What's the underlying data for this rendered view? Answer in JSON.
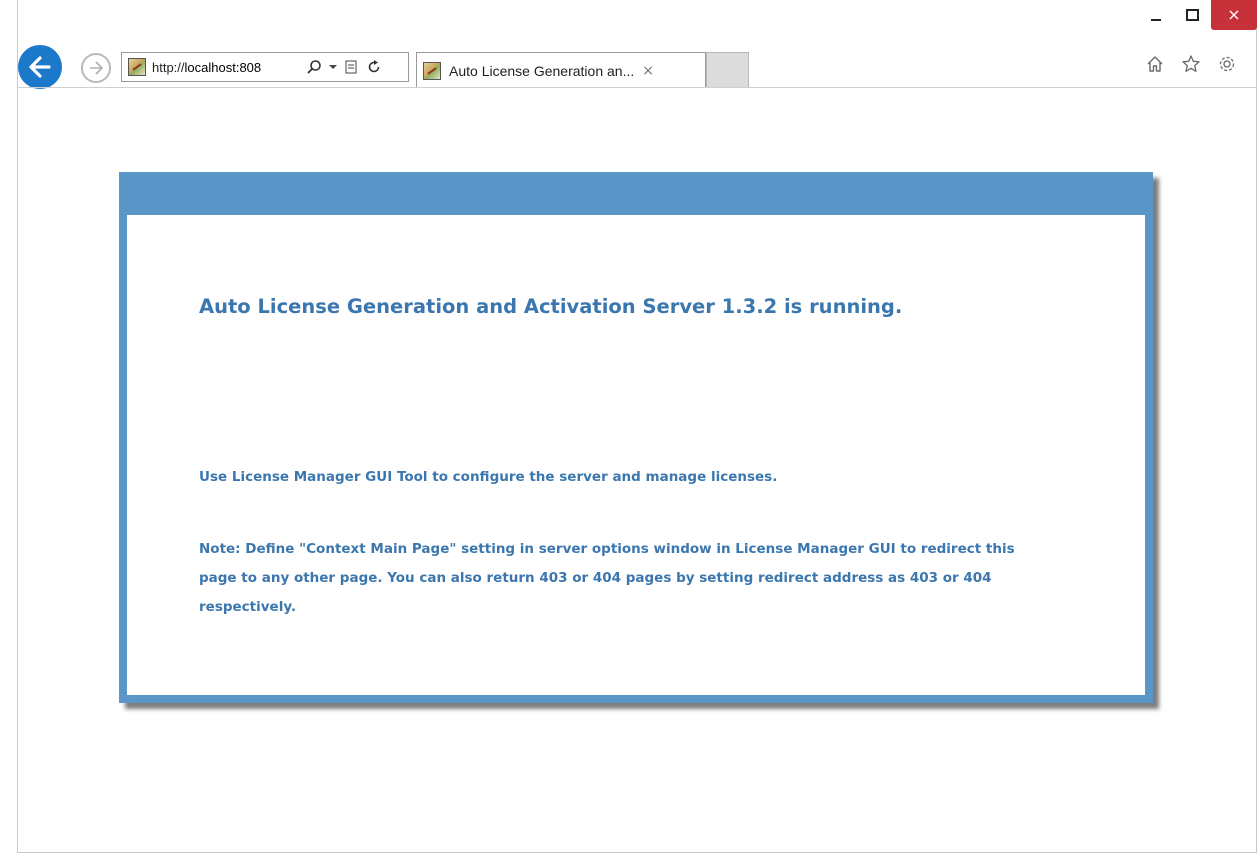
{
  "browser": {
    "address_url_prefix": "http://",
    "address_url_host": "localhost:808",
    "tab_title": "Auto License Generation an...",
    "tab_close_glyph": "×",
    "close_glyph": "×",
    "icons": [
      "back-icon",
      "forward-icon",
      "search-icon",
      "dropdown-icon",
      "compat-view-icon",
      "refresh-icon",
      "home-icon",
      "favorites-icon",
      "settings-icon"
    ]
  },
  "page": {
    "headline": "Auto License Generation and Activation Server 1.3.2 is running.",
    "line1": "Use License Manager GUI Tool to configure the server and manage licenses.",
    "note": "Note: Define \"Context Main Page\" setting in server options window in License Manager GUI to redirect this page to any other page. You can also return 403 or 404 pages by setting redirect address as 403 or 404 respectively."
  },
  "colors": {
    "panel_border": "#5a96c8",
    "text_blue": "#3b77ae",
    "back_button": "#1c78c8",
    "close_button": "#c7323a"
  }
}
